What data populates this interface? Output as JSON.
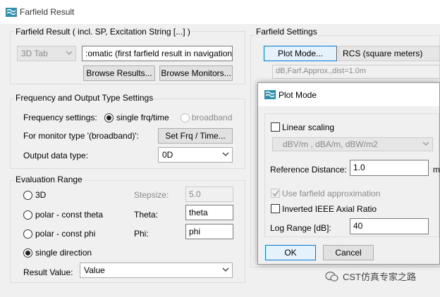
{
  "window": {
    "title": "Farfield Result"
  },
  "result_group": {
    "label": "Farfield Result ( incl. SP, Excitation String [...] )",
    "tab_combo": "3D Tab",
    "result_name": ":omatic (first farfield result in navigation tree)",
    "browse_results": "Browse Results...",
    "browse_monitors": "Browse Monitors..."
  },
  "farfield_settings": {
    "label": "Farfield Settings",
    "plot_mode_button": "Plot Mode...",
    "rcs_value": "RCS (square meters)",
    "info_text": "dB,Farf.Approx.,dist=1.0m"
  },
  "freq_group": {
    "label": "Frequency and Output Type Settings",
    "freq_label": "Frequency settings:",
    "single": "single frq/time",
    "broadband": "broadband",
    "monitor_label": "For monitor type '(broadband)':",
    "set_frq_button": "Set Frq / Time...",
    "output_label": "Output data type:",
    "output_value": "0D"
  },
  "eval_group": {
    "label": "Evaluation Range",
    "opt_3d": "3D",
    "opt_polar_theta": "polar - const theta",
    "opt_polar_phi": "polar - const phi",
    "opt_single": "single direction",
    "stepsize_label": "Stepsize:",
    "stepsize_value": "5.0",
    "theta_label": "Theta:",
    "theta_value": "theta",
    "phi_label": "Phi:",
    "phi_value": "phi",
    "result_label": "Result Value:",
    "result_value": "Value"
  },
  "plot_mode_dialog": {
    "title": "Plot Mode",
    "linear_scaling": "Linear scaling",
    "units_value": "dBV/m , dBA/m,  dBW/m2",
    "ref_distance_label": "Reference Distance:",
    "ref_distance_value": "1.0",
    "ref_unit": "m",
    "use_farfield": "Use farfield approximation",
    "inverted_ieee": "Inverted IEEE Axial Ratio",
    "log_range_label": "Log Range [dB]:",
    "log_range_value": "40",
    "ok": "OK",
    "cancel": "Cancel"
  },
  "watermark": {
    "text": "CST仿真专家之路"
  },
  "colors": {
    "accent": "#0078d7",
    "icon": "#3a9bb5"
  }
}
